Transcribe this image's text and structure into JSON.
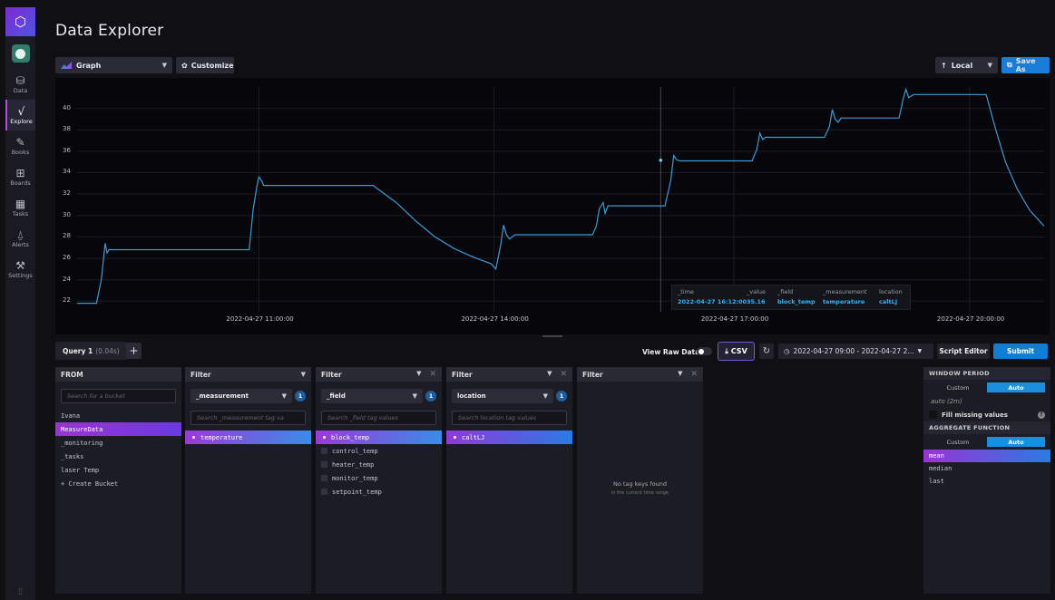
{
  "sidebar": {
    "items": [
      {
        "label": "Data",
        "icon": "database-icon",
        "glyph": "⛁"
      },
      {
        "label": "Explore",
        "icon": "explore-icon",
        "glyph": "√"
      },
      {
        "label": "Books",
        "icon": "notebook-icon",
        "glyph": "✎"
      },
      {
        "label": "Boards",
        "icon": "dashboard-icon",
        "glyph": "⊞"
      },
      {
        "label": "Tasks",
        "icon": "calendar-icon",
        "glyph": "▦"
      },
      {
        "label": "Alerts",
        "icon": "bell-icon",
        "glyph": "⍙"
      },
      {
        "label": "Settings",
        "icon": "wrench-icon",
        "glyph": "⚒"
      }
    ]
  },
  "header": {
    "title": "Data Explorer"
  },
  "toolbar": {
    "graph_label": "Graph",
    "customize_label": "Customize",
    "local_label": "Local",
    "save_label": "Save As"
  },
  "chart_data": {
    "type": "line",
    "y_ticks": [
      "22",
      "24",
      "26",
      "28",
      "30",
      "32",
      "34",
      "36",
      "38",
      "40"
    ],
    "x_ticks": [
      "2022-04-27 11:00:00",
      "2022-04-27 14:00:00",
      "2022-04-27 17:00:00",
      "2022-04-27 20:00:00"
    ],
    "ylim": [
      21,
      42
    ],
    "line_color": "#3a9bd6",
    "points": [
      [
        0.0,
        21.8
      ],
      [
        0.02,
        21.8
      ],
      [
        0.025,
        24.0
      ],
      [
        0.028,
        26.5
      ],
      [
        0.029,
        27.4
      ],
      [
        0.031,
        26.5
      ],
      [
        0.033,
        26.8
      ],
      [
        0.178,
        26.8
      ],
      [
        0.182,
        30.5
      ],
      [
        0.186,
        32.8
      ],
      [
        0.188,
        33.6
      ],
      [
        0.191,
        33.2
      ],
      [
        0.193,
        32.8
      ],
      [
        0.306,
        32.8
      ],
      [
        0.33,
        31.2
      ],
      [
        0.35,
        29.5
      ],
      [
        0.37,
        28.0
      ],
      [
        0.39,
        26.9
      ],
      [
        0.41,
        26.1
      ],
      [
        0.428,
        25.5
      ],
      [
        0.433,
        25.0
      ],
      [
        0.438,
        27.2
      ],
      [
        0.441,
        29.1
      ],
      [
        0.444,
        28.2
      ],
      [
        0.447,
        27.8
      ],
      [
        0.45,
        28.0
      ],
      [
        0.453,
        28.2
      ],
      [
        0.533,
        28.2
      ],
      [
        0.537,
        29.0
      ],
      [
        0.54,
        30.6
      ],
      [
        0.544,
        31.2
      ],
      [
        0.546,
        30.2
      ],
      [
        0.549,
        30.9
      ],
      [
        0.556,
        30.9
      ],
      [
        0.608,
        30.9
      ],
      [
        0.614,
        33.3
      ],
      [
        0.617,
        35.6
      ],
      [
        0.62,
        35.2
      ],
      [
        0.623,
        35.1
      ],
      [
        0.698,
        35.1
      ],
      [
        0.703,
        36.2
      ],
      [
        0.706,
        37.7
      ],
      [
        0.709,
        37.1
      ],
      [
        0.712,
        37.3
      ],
      [
        0.773,
        37.3
      ],
      [
        0.778,
        38.3
      ],
      [
        0.781,
        39.9
      ],
      [
        0.784,
        39.0
      ],
      [
        0.787,
        38.7
      ],
      [
        0.79,
        39.1
      ],
      [
        0.85,
        39.1
      ],
      [
        0.854,
        40.8
      ],
      [
        0.857,
        41.8
      ],
      [
        0.86,
        41.0
      ],
      [
        0.865,
        41.3
      ],
      [
        0.94,
        41.3
      ],
      [
        0.941,
        41.0
      ],
      [
        0.95,
        38.0
      ],
      [
        0.96,
        35.0
      ],
      [
        0.972,
        32.5
      ],
      [
        0.985,
        30.5
      ],
      [
        1.0,
        29.0
      ]
    ],
    "cursor_x": 0.6035,
    "tooltip": {
      "headers": [
        "_time",
        "_value",
        "_field",
        "_measurement",
        "location"
      ],
      "values": [
        "2022-04-27 16:12:00",
        "35.16",
        "block_temp",
        "temperature",
        "caltLJ"
      ]
    }
  },
  "query": {
    "tab_label": "Query 1",
    "tab_time": "(0.04s)",
    "add_label": "+",
    "raw_label": "View Raw Data",
    "csv_label": "CSV",
    "time_range": "2022-04-27 09:00 - 2022-04-27 2...",
    "script_label": "Script Editor",
    "submit_label": "Submit"
  },
  "from": {
    "header": "FROM",
    "search_placeholder": "Search for a bucket",
    "buckets": [
      "Ivana",
      "MeasureData",
      "_monitoring",
      "_tasks",
      "laser Temp",
      "+ Create Bucket"
    ],
    "selected": 1
  },
  "filters": [
    {
      "header": "Filter",
      "key": "_measurement",
      "count": "1",
      "search": "Search _measurement tag va",
      "values": [
        "temperature"
      ],
      "selected": [
        0
      ]
    },
    {
      "header": "Filter",
      "key": "_field",
      "count": "1",
      "search": "Search _field tag values",
      "values": [
        "block_temp",
        "control_temp",
        "heater_temp",
        "monitor_temp",
        "setpoint_temp"
      ],
      "selected": [
        0
      ]
    },
    {
      "header": "Filter",
      "key": "location",
      "count": "1",
      "search": "Search location tag values",
      "values": [
        "caltLJ"
      ],
      "selected": [
        0
      ]
    },
    {
      "header": "Filter",
      "empty_title": "No tag keys found",
      "empty_sub": "in the current time range"
    }
  ],
  "window": {
    "header": "WINDOW PERIOD",
    "custom": "Custom",
    "auto": "Auto",
    "auto_value": "auto (2m)",
    "fill_label": "Fill missing values",
    "agg_header": "AGGREGATE FUNCTION",
    "functions": [
      "mean",
      "median",
      "last"
    ],
    "selected": 0
  }
}
